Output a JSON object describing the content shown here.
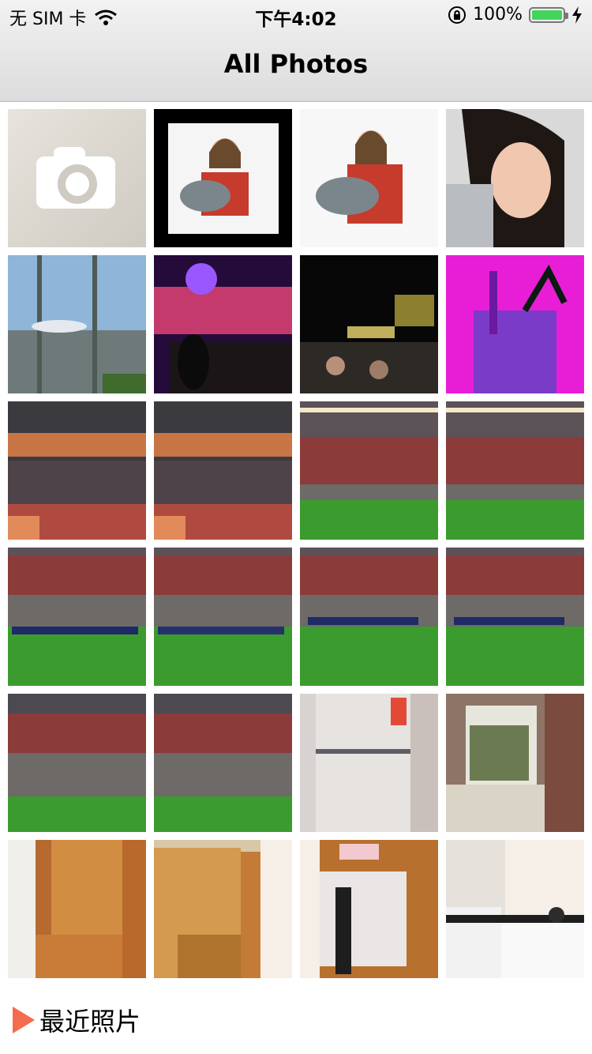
{
  "status_bar": {
    "carrier": "无 SIM 卡",
    "time": "下午4:02",
    "battery": "100%",
    "battery_level": 1.0,
    "icons": [
      "wifi-icon",
      "orientation-lock-icon",
      "battery-icon",
      "charging-icon"
    ]
  },
  "header": {
    "title": "All Photos"
  },
  "grid": {
    "columns": 4,
    "first_tile": "camera-icon",
    "thumbnails": [
      "photo-girl-guitar-framed",
      "photo-girl-guitar",
      "photo-girl-portrait",
      "photo-airport",
      "photo-concert",
      "photo-night-street",
      "photo-pink-drink",
      "photo-stadium-crowd-1",
      "photo-stadium-crowd-2",
      "photo-stadium-field-1",
      "photo-stadium-field-2",
      "photo-stadium-teams-1",
      "photo-stadium-teams-2",
      "photo-stadium-teams-3",
      "photo-stadium-teams-4",
      "photo-stadium-teams-5",
      "photo-stadium-teams-6",
      "photo-refrigerator",
      "photo-bedroom",
      "photo-wardrobe-1",
      "photo-wardrobe-2",
      "photo-wardrobe-3",
      "photo-kitchen"
    ]
  },
  "footer": {
    "album_label": "最近照片",
    "accent_color": "#f56b4d"
  }
}
